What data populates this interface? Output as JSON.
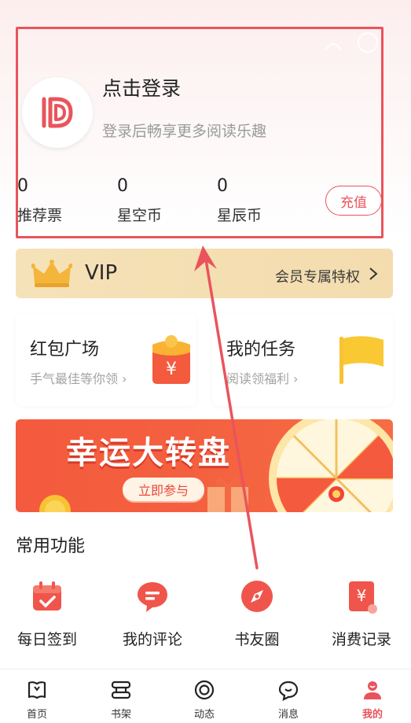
{
  "login": {
    "title": "点击登录",
    "subtitle": "登录后畅享更多阅读乐趣"
  },
  "stats": [
    {
      "value": "0",
      "label": "推荐票"
    },
    {
      "value": "0",
      "label": "星空币"
    },
    {
      "value": "0",
      "label": "星辰币"
    }
  ],
  "recharge_label": "充值",
  "vip": {
    "title": "VIP",
    "link_text": "会员专属特权"
  },
  "cards": [
    {
      "title": "红包广场",
      "subtitle": "手气最佳等你领 ›"
    },
    {
      "title": "我的任务",
      "subtitle": "阅读领福利 ›"
    }
  ],
  "banner": {
    "title": "幸运大转盘",
    "button": "立即参与"
  },
  "common_section_title": "常用功能",
  "functions": [
    {
      "label": "每日签到",
      "icon": "calendar-check-icon"
    },
    {
      "label": "我的评论",
      "icon": "comment-bubble-icon"
    },
    {
      "label": "书友圈",
      "icon": "compass-icon"
    },
    {
      "label": "消费记录",
      "icon": "yen-receipt-icon"
    }
  ],
  "tabs": [
    {
      "label": "首页",
      "icon": "book-home-icon",
      "active": false
    },
    {
      "label": "书架",
      "icon": "bookshelf-icon",
      "active": false
    },
    {
      "label": "动态",
      "icon": "circle-target-icon",
      "active": false
    },
    {
      "label": "消息",
      "icon": "chat-bubble-icon",
      "active": false
    },
    {
      "label": "我的",
      "icon": "user-icon",
      "active": true
    }
  ],
  "colors": {
    "accent": "#e9545c",
    "vip_gold": "#f4deb1",
    "banner_orange": "#f45a3e"
  }
}
